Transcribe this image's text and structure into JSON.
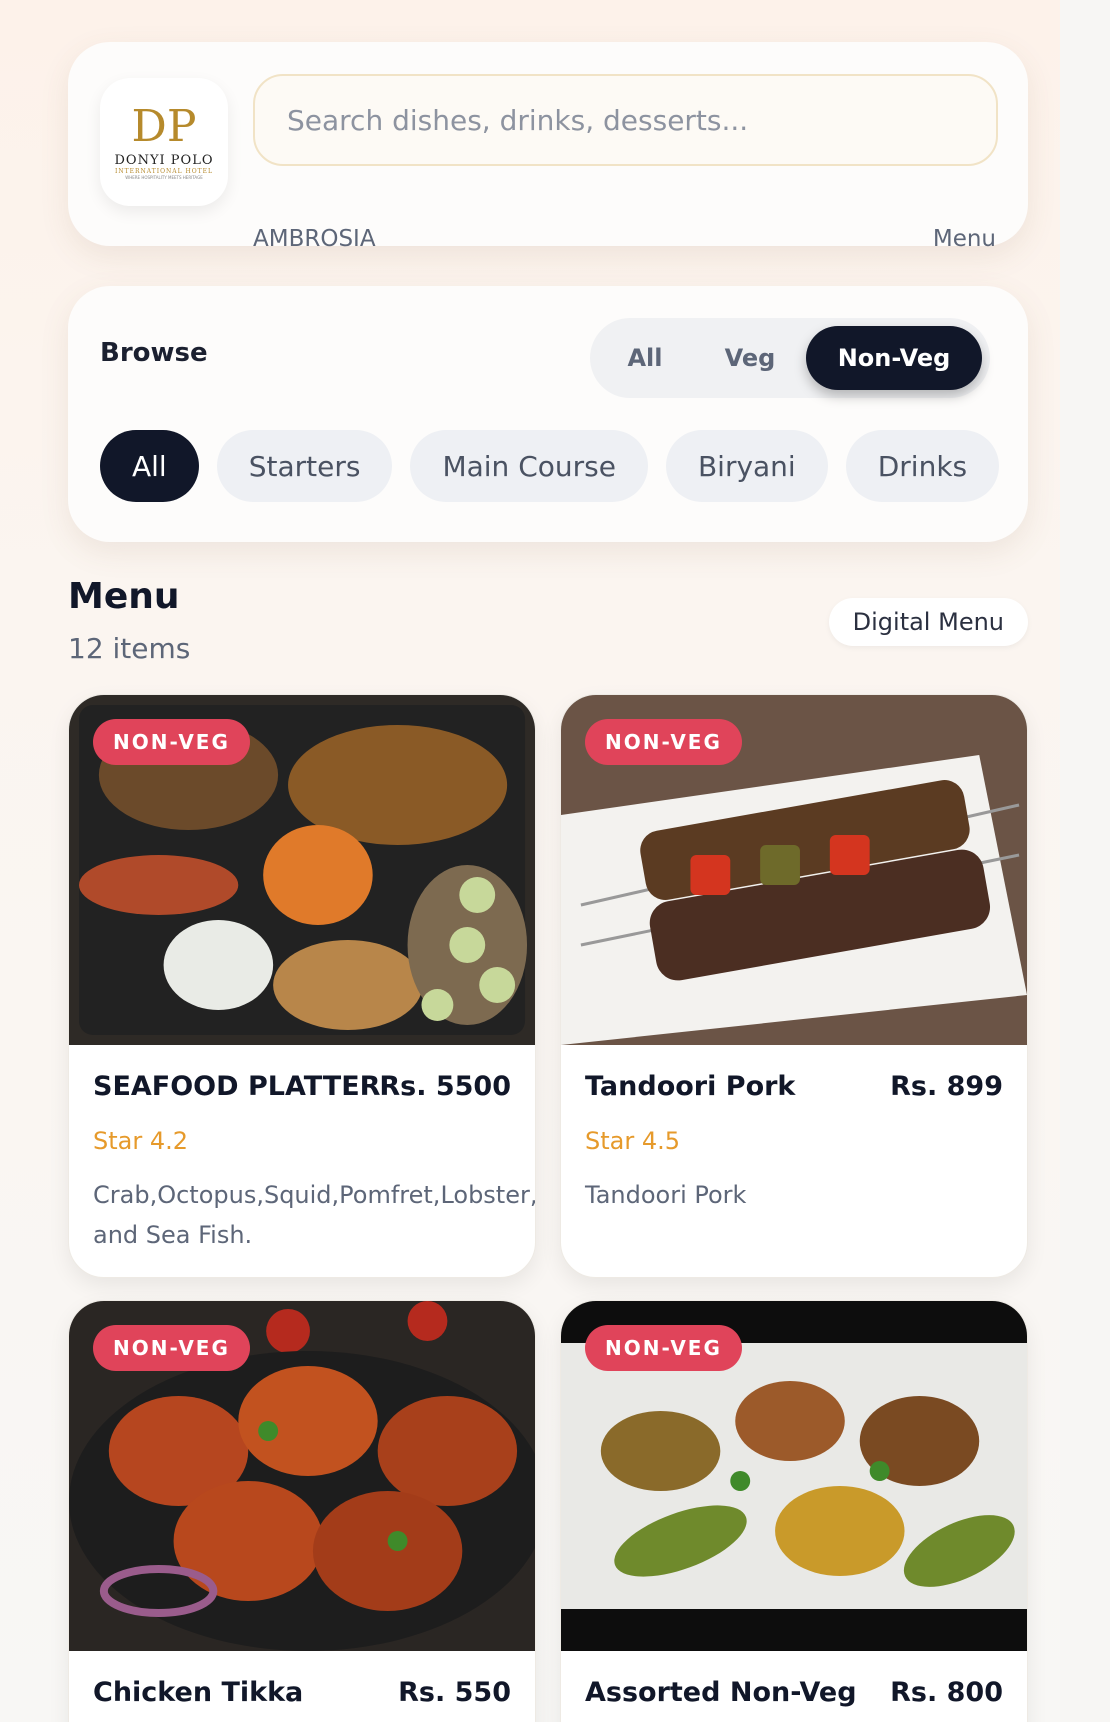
{
  "header": {
    "logo": {
      "monogram": "DP",
      "name": "DONYI POLO",
      "subtitle": "INTERNATIONAL HOTEL",
      "tagline": "WHERE HOSPITALITY MEETS HERITAGE"
    },
    "search": {
      "placeholder": "Search dishes, drinks, desserts..."
    },
    "brand": "AMBROSIA",
    "menu_link": "Menu"
  },
  "filters": {
    "browse_label": "Browse",
    "diet_options": [
      "All",
      "Veg",
      "Non-Veg"
    ],
    "diet_selected": "Non-Veg",
    "categories": [
      "All",
      "Starters",
      "Main Course",
      "Biryani",
      "Drinks"
    ],
    "category_selected": "All"
  },
  "menu": {
    "title": "Menu",
    "count": "12 items",
    "digital_menu_button": "Digital Menu",
    "items": [
      {
        "badge": "NON-VEG",
        "name": "SEAFOOD PLATTER",
        "price": "Rs. 5500",
        "rating": "Star 4.2",
        "description": "Crab,Octopus,Squid,Pomfret,Lobster,Prawns and Sea Fish."
      },
      {
        "badge": "NON-VEG",
        "name": "Tandoori Pork",
        "price": "Rs. 899",
        "rating": "Star 4.5",
        "description": "Tandoori Pork"
      },
      {
        "badge": "NON-VEG",
        "name": "Chicken Tikka",
        "price": "Rs. 550"
      },
      {
        "badge": "NON-VEG",
        "name": "Assorted Non-Veg",
        "price": "Rs. 800"
      }
    ]
  },
  "colors": {
    "accent_dark": "#111729",
    "badge_red": "#e0445a",
    "rating_orange": "#e69a2b",
    "logo_gold": "#b68a2c"
  }
}
